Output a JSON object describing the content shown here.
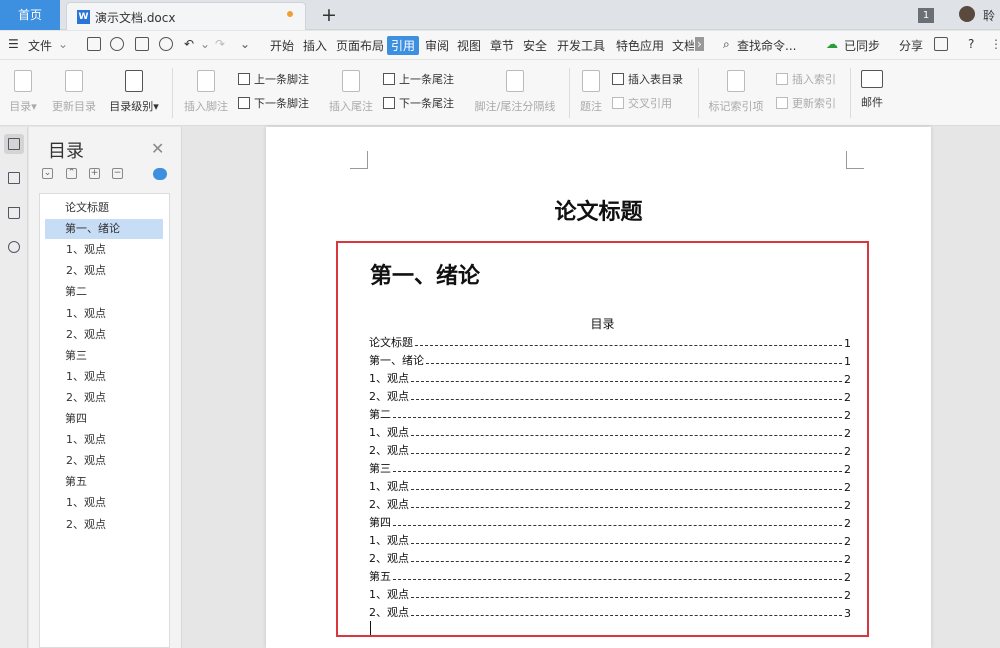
{
  "tabs": {
    "home": "首页",
    "doc": "演示文档.docx"
  },
  "window": {
    "badge": "1",
    "user": "聆"
  },
  "menu": {
    "file": "文件",
    "items": [
      "开始",
      "插入",
      "页面布局",
      "引用",
      "审阅",
      "视图",
      "章节",
      "安全",
      "开发工具",
      "特色应用",
      "文档"
    ],
    "active_index": 3,
    "search": "查找命令...",
    "sync": "已同步",
    "share": "分享",
    "help": "?"
  },
  "ribbon": {
    "toc": "目录",
    "update_toc": "更新目录",
    "toc_level": "目录级别",
    "insert_footnote": "插入脚注",
    "prev_footnote": "上一条脚注",
    "next_footnote": "下一条脚注",
    "insert_endnote": "插入尾注",
    "prev_endnote": "上一条尾注",
    "next_endnote": "下一条尾注",
    "fn_separator": "脚注/尾注分隔线",
    "caption": "题注",
    "insert_table_of_figures": "插入表目录",
    "cross_ref": "交叉引用",
    "mark_index": "标记索引项",
    "insert_index": "插入索引",
    "update_index": "更新索引",
    "mail": "邮件"
  },
  "nav": {
    "title": "目录",
    "items": [
      {
        "label": "论文标题",
        "level": 1
      },
      {
        "label": "第一、绪论",
        "level": 1,
        "selected": true
      },
      {
        "label": "1、观点",
        "level": 2
      },
      {
        "label": "2、观点",
        "level": 2
      },
      {
        "label": "第二",
        "level": 1
      },
      {
        "label": "1、观点",
        "level": 2
      },
      {
        "label": "2、观点",
        "level": 2
      },
      {
        "label": "第三",
        "level": 1
      },
      {
        "label": "1、观点",
        "level": 2
      },
      {
        "label": "2、观点",
        "level": 2
      },
      {
        "label": "第四",
        "level": 1
      },
      {
        "label": "1、观点",
        "level": 2
      },
      {
        "label": "2、观点",
        "level": 2
      },
      {
        "label": "第五",
        "level": 1
      },
      {
        "label": "1、观点",
        "level": 2
      },
      {
        "label": "2、观点",
        "level": 2
      }
    ]
  },
  "document": {
    "title": "论文标题",
    "heading1": "第一、绪论",
    "toc_title": "目录",
    "toc": [
      {
        "text": "论文标题",
        "page": "1"
      },
      {
        "text": "第一、绪论",
        "page": "1"
      },
      {
        "text": "1、观点",
        "page": "2"
      },
      {
        "text": "2、观点",
        "page": "2"
      },
      {
        "text": "第二",
        "page": "2"
      },
      {
        "text": "1、观点",
        "page": "2"
      },
      {
        "text": "2、观点",
        "page": "2"
      },
      {
        "text": "第三",
        "page": "2"
      },
      {
        "text": "1、观点",
        "page": "2"
      },
      {
        "text": "2、观点",
        "page": "2"
      },
      {
        "text": "第四",
        "page": "2"
      },
      {
        "text": "1、观点",
        "page": "2"
      },
      {
        "text": "2、观点",
        "page": "2"
      },
      {
        "text": "第五",
        "page": "2"
      },
      {
        "text": "1、观点",
        "page": "2"
      },
      {
        "text": "2、观点",
        "page": "3"
      }
    ]
  },
  "colors": {
    "accent": "#3d8fe0",
    "highlight_box": "#d9363e"
  }
}
